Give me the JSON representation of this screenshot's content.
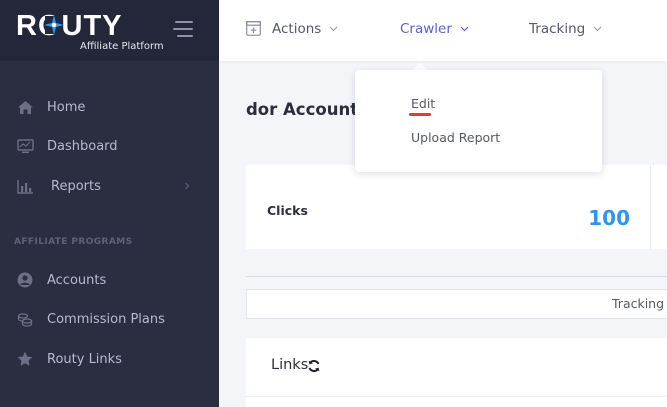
{
  "brand": {
    "logo_text": "ROUTY",
    "subtitle": "Affiliate Platform"
  },
  "sidebar": {
    "items": [
      {
        "label": "Home",
        "icon": "home-icon"
      },
      {
        "label": "Dashboard",
        "icon": "monitor-icon"
      },
      {
        "label": "Reports",
        "icon": "bar-chart-icon"
      }
    ],
    "section_label": "AFFILIATE PROGRAMS",
    "program_items": [
      {
        "label": "Accounts",
        "icon": "user-circle-icon"
      },
      {
        "label": "Commission Plans",
        "icon": "coins-icon"
      },
      {
        "label": "Routy Links",
        "icon": "star-icon"
      }
    ]
  },
  "topbar": {
    "menus": [
      {
        "label": "Actions",
        "icon": "add-square-icon"
      },
      {
        "label": "Crawler"
      },
      {
        "label": "Tracking"
      }
    ]
  },
  "dropdown": {
    "items": [
      {
        "label": "Edit"
      },
      {
        "label": "Upload Report"
      }
    ]
  },
  "main": {
    "page_title": "dor Account",
    "clicks": {
      "label": "Clicks",
      "value": "100"
    },
    "tab_label": "Tracking",
    "links_title": "Links"
  },
  "colors": {
    "sidebar_bg": "#2b2e40",
    "accent_blue": "#2e96f0",
    "active_menu": "#5b60d6",
    "underline_red": "#e53935"
  }
}
